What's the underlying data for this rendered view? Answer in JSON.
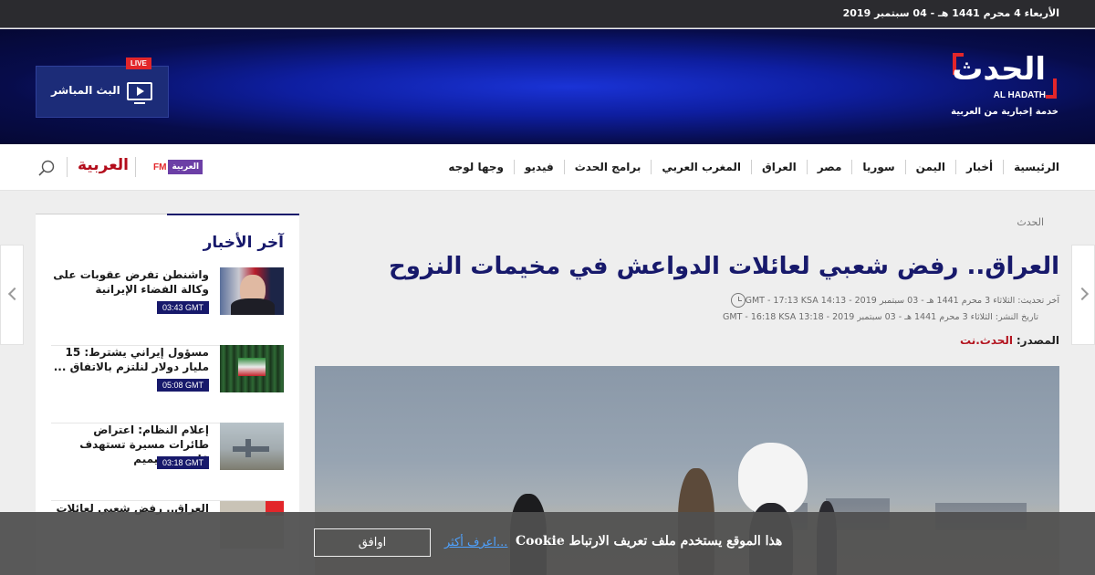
{
  "topbar": {
    "date": "الأربعاء 4 محرم 1441 هـ - 04 سبتمبر 2019"
  },
  "brand": {
    "logo_ar": "الحدث",
    "logo_en": "AL HADATH",
    "tagline": "خدمة إخبارية من العربية",
    "accent": "#e2262a"
  },
  "live": {
    "badge": "LIVE",
    "label": "البث المباشر",
    "icon": "tv-play-icon"
  },
  "nav": {
    "items": [
      "الرئيسية",
      "أخبار",
      "اليمن",
      "سوريا",
      "مصر",
      "العراق",
      "المغرب العربي",
      "برامج الحدث",
      "فيديو",
      "وجها لوجه"
    ],
    "alarabiya": "العربية",
    "fm_prefix": "FM",
    "fm_box": "العربية",
    "search_icon": "search-icon"
  },
  "article": {
    "breadcrumb": "الحدث",
    "title": "العراق.. رفض شعبي لعائلات الدواعش في مخيمات النزوح",
    "updated": "آخر تحديث: الثلاثاء 3 محرم 1441 هـ - 03 سبتمبر 2019 - 14:13 GMT - 17:13 KSA",
    "published": "تاريخ النشر: الثلاثاء 3 محرم 1441 هـ - 03 سبتمبر 2019 - 13:18 GMT - 16:18 KSA",
    "source_label": "المصدر:",
    "source_value": "الحدث.نت",
    "title_color": "#17196b"
  },
  "sidebar": {
    "title": "آخر الأخبار",
    "items": [
      {
        "headline": "واشنطن تفرض عقوبات على وكالة الفضاء الإيرانية",
        "time": "03:43 GMT"
      },
      {
        "headline": "مسؤول إيراني يشترط: 15 مليار دولار لنلتزم بالاتفاق ...",
        "time": "05:08 GMT"
      },
      {
        "headline": "إعلام النظام: اعتراض طائرات مسيرة تستهدف قاعدة حميميم",
        "time": "03:18 GMT"
      },
      {
        "headline": "العراق.. رفض شعبي لعائلات",
        "time": ""
      }
    ]
  },
  "cookie": {
    "message": "هذا الموقع يستخدم ملف تعريف الارتباط Cookie",
    "learn_more": "...اعرف أكثر",
    "accept": "اوافق"
  }
}
